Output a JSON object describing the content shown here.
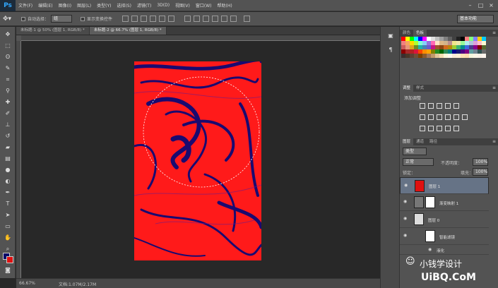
{
  "app": {
    "logo": "Ps"
  },
  "menu": [
    "文件(F)",
    "编辑(E)",
    "图像(I)",
    "图层(L)",
    "类型(Y)",
    "选择(S)",
    "滤镜(T)",
    "3D(D)",
    "视图(V)",
    "窗口(W)",
    "帮助(H)"
  ],
  "window_controls": [
    "–",
    "□",
    "×"
  ],
  "options_bar": {
    "auto_select_label": "自动选择：",
    "auto_select_value": "组",
    "show_transform_label": "显示变换控件",
    "workspace": "基本功能"
  },
  "tabs": [
    {
      "label": "未标题-1 @ 50% (图层 1, RGB/8) *",
      "active": false
    },
    {
      "label": "未标题-2 @ 66.7% (图层 1, RGB/8) *",
      "active": true
    }
  ],
  "status": {
    "zoom": "66.67%",
    "doc": "文档:1.07M/2.17M"
  },
  "tools": [
    "move",
    "marquee",
    "lasso",
    "quick-select",
    "crop",
    "eyedropper",
    "healing",
    "brush",
    "stamp",
    "history-brush",
    "eraser",
    "gradient",
    "blur",
    "dodge",
    "pen",
    "type",
    "path-select",
    "shape",
    "hand",
    "zoom"
  ],
  "swatch_panel": {
    "tabs": [
      "颜色",
      "色板"
    ],
    "active": 1
  },
  "adjust_panel": {
    "tabs": [
      "调整",
      "样式"
    ],
    "active": 0,
    "title": "添加调整"
  },
  "layers_panel": {
    "tabs": [
      "图层",
      "通道",
      "路径"
    ],
    "filter_kind": "类型",
    "blend_mode": "正常",
    "opacity_label": "不透明度：",
    "opacity": "100%",
    "lock_label": "锁定：",
    "fill_label": "填充：",
    "fill": "100%",
    "layers": [
      {
        "name": "图层 1",
        "selected": true
      },
      {
        "name": "渐变映射 1",
        "selected": false
      },
      {
        "name": "图层 0",
        "selected": false
      },
      {
        "name": "智能滤镜",
        "selected": false
      },
      {
        "name": "液化",
        "selected": false
      }
    ]
  },
  "watermark": {
    "text": "小钱学设计",
    "brand": "UiBQ.CoM"
  },
  "colors": {
    "fg": "#0b0a68",
    "bg": "#e01010",
    "canvas_red": "#ff1a1a",
    "swirl_blue": "#1a0a70"
  }
}
